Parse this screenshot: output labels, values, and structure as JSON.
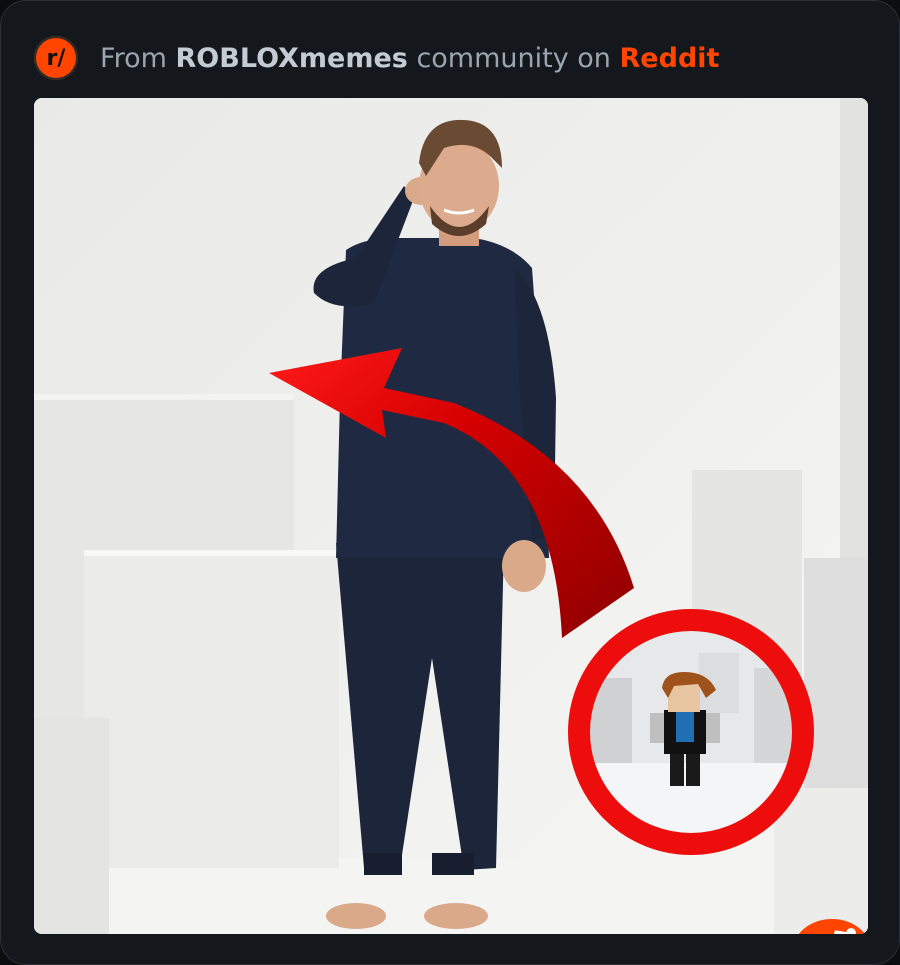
{
  "header": {
    "prefix": "From",
    "community": "ROBLOXmemes",
    "middle": "community on",
    "platform": "Reddit",
    "subreddit_icon_text": "r/"
  },
  "colors": {
    "brand": "#ff4500",
    "card_bg": "#14181c",
    "page_bg": "#0b0e11"
  },
  "media": {
    "icon": "reddit-snoo-icon"
  }
}
